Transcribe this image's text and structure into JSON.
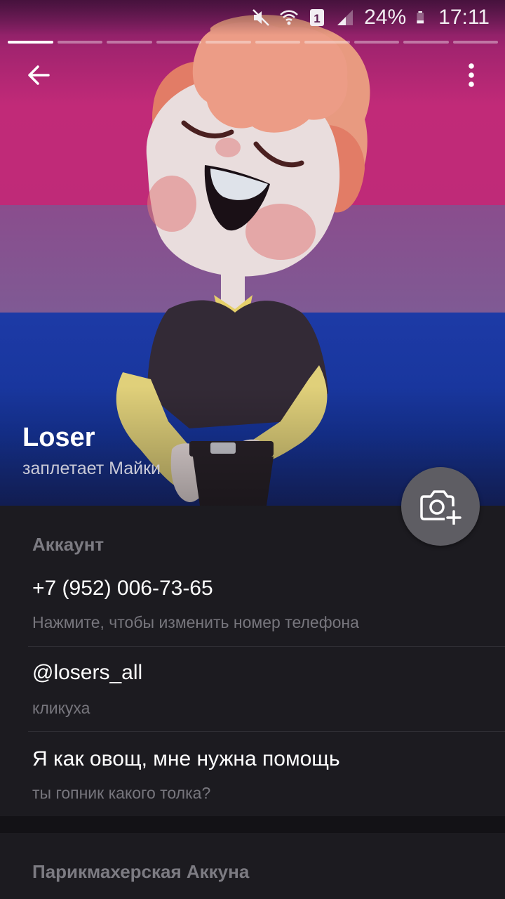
{
  "status_bar": {
    "icons": [
      "mute-icon",
      "wifi-icon",
      "sim-1-icon",
      "signal-icon",
      "battery-icon"
    ],
    "battery": "24%",
    "time": "17:11"
  },
  "story_progress": {
    "segments": 10,
    "active_index": 0
  },
  "profile": {
    "name": "Loser",
    "status": "заплетает Майки"
  },
  "account": {
    "title": "Аккаунт",
    "phone": {
      "value": "+7 (952) 006-73-65",
      "hint": "Нажмите, чтобы изменить номер телефона"
    },
    "username": {
      "value": "@losers_all",
      "hint": "кликуха"
    },
    "bio": {
      "value": "Я как овощ, мне нужна помощь",
      "hint": "ты гопник какого толка?"
    }
  },
  "next_section": {
    "title": "Парикмахерская Аккуна"
  },
  "colors": {
    "flag_pink": "#c12a78",
    "flag_purple": "#7f5a94",
    "flag_blue": "#1d3aa6",
    "background": "#1c1b20",
    "fab": "#5e5d63"
  }
}
